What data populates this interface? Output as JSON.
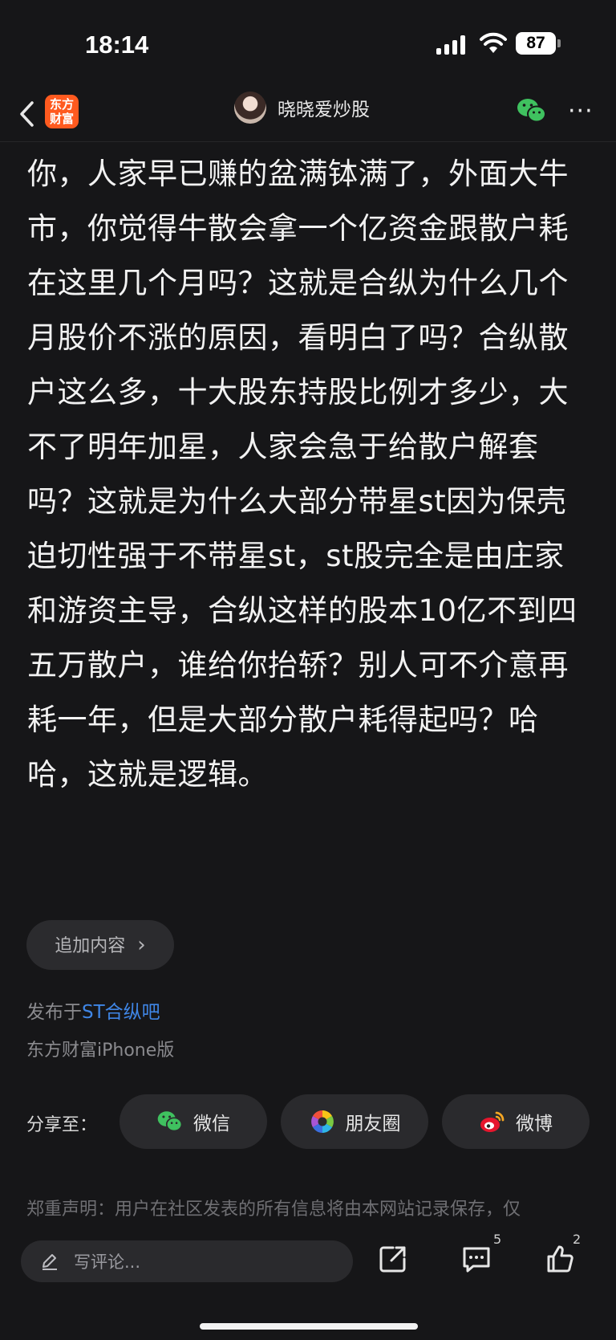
{
  "status_bar": {
    "time": "18:14",
    "battery": "87"
  },
  "nav": {
    "logo_line1": "东方",
    "logo_line2": "财富",
    "author": "晓晓爱炒股"
  },
  "article": {
    "text": "你，人家早已赚的盆满钵满了，外面大牛市，你觉得牛散会拿一个亿资金跟散户耗在这里几个月吗？这就是合纵为什么几个月股价不涨的原因，看明白了吗？合纵散户这么多，十大股东持股比例才多少，大不了明年加星，人家会急于给散户解套吗？这就是为什么大部分带星st因为保壳迫切性强于不带星st，st股完全是由庄家和游资主导，合纵这样的股本10亿不到四五万散户，谁给你抬轿？别人可不介意再耗一年，但是大部分散户耗得起吗？哈哈，这就是逻辑。"
  },
  "append_label": "追加内容",
  "append_chevron": "›",
  "posted": {
    "prefix": "发布于",
    "forum": "ST合纵吧"
  },
  "client": "东方财富iPhone版",
  "share": {
    "label": "分享至：",
    "options": [
      {
        "label": "微信",
        "icon": "wechat-icon"
      },
      {
        "label": "朋友圈",
        "icon": "moments-icon"
      },
      {
        "label": "微博",
        "icon": "weibo-icon"
      }
    ]
  },
  "disclaimer": "郑重声明：用户在社区发表的所有信息将由本网站记录保存，仅",
  "bottom": {
    "comment_placeholder": "写评论...",
    "comment_count": "5",
    "like_count": "2"
  },
  "colors": {
    "background": "#161618",
    "brand": "#ff5a1f",
    "link": "#3f86e6",
    "wechat_green": "#3fc15f"
  }
}
